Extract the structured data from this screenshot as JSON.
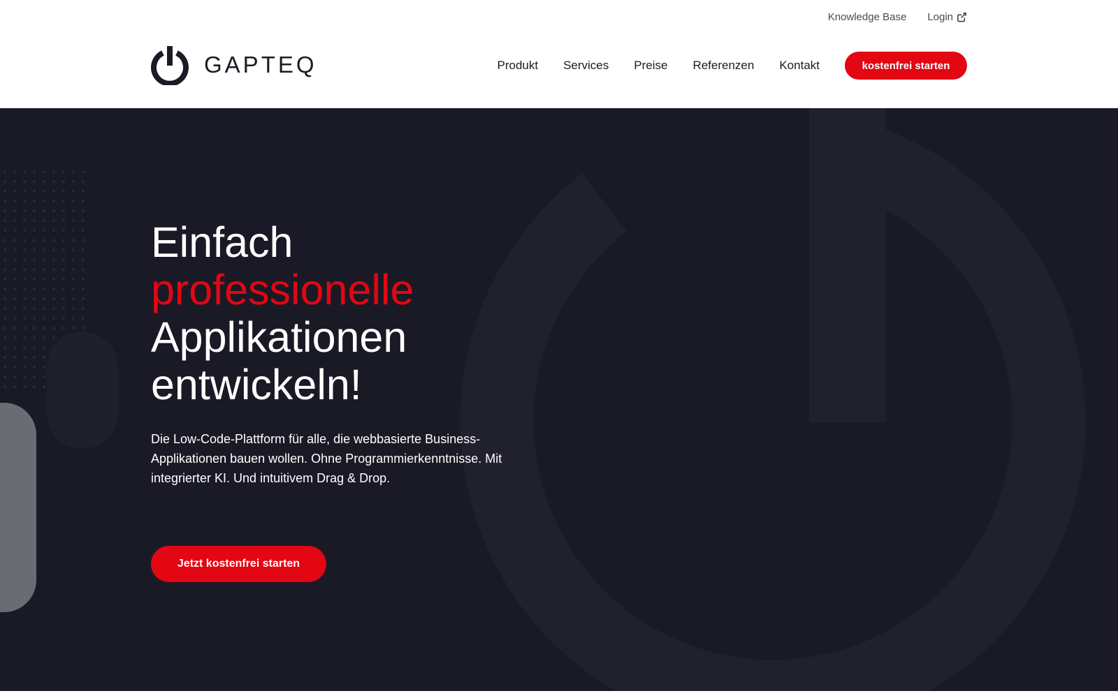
{
  "topbar": {
    "knowledge_base": "Knowledge Base",
    "login": "Login"
  },
  "logo": {
    "text": "GAPTEQ"
  },
  "nav": {
    "items": [
      {
        "label": "Produkt"
      },
      {
        "label": "Services"
      },
      {
        "label": "Preise"
      },
      {
        "label": "Referenzen"
      },
      {
        "label": "Kontakt"
      }
    ],
    "cta": "kostenfrei starten"
  },
  "hero": {
    "headline_line1": "Einfach",
    "headline_line2": "professionelle",
    "headline_line3": "Applikationen",
    "headline_line4": "entwickeln!",
    "description": "Die Low-Code-Plattform für alle, die webbasierte Business-Applikationen bauen wollen. Ohne Programmierkenntnisse. Mit integrierter KI. Und intuitivem Drag & Drop.",
    "cta": "Jetzt kostenfrei starten"
  },
  "colors": {
    "accent": "#e30613",
    "hero_background": "#1a1a26",
    "text_dark": "#1b1b26"
  },
  "icons": {
    "logo": "power-icon",
    "login": "external-link-icon"
  }
}
